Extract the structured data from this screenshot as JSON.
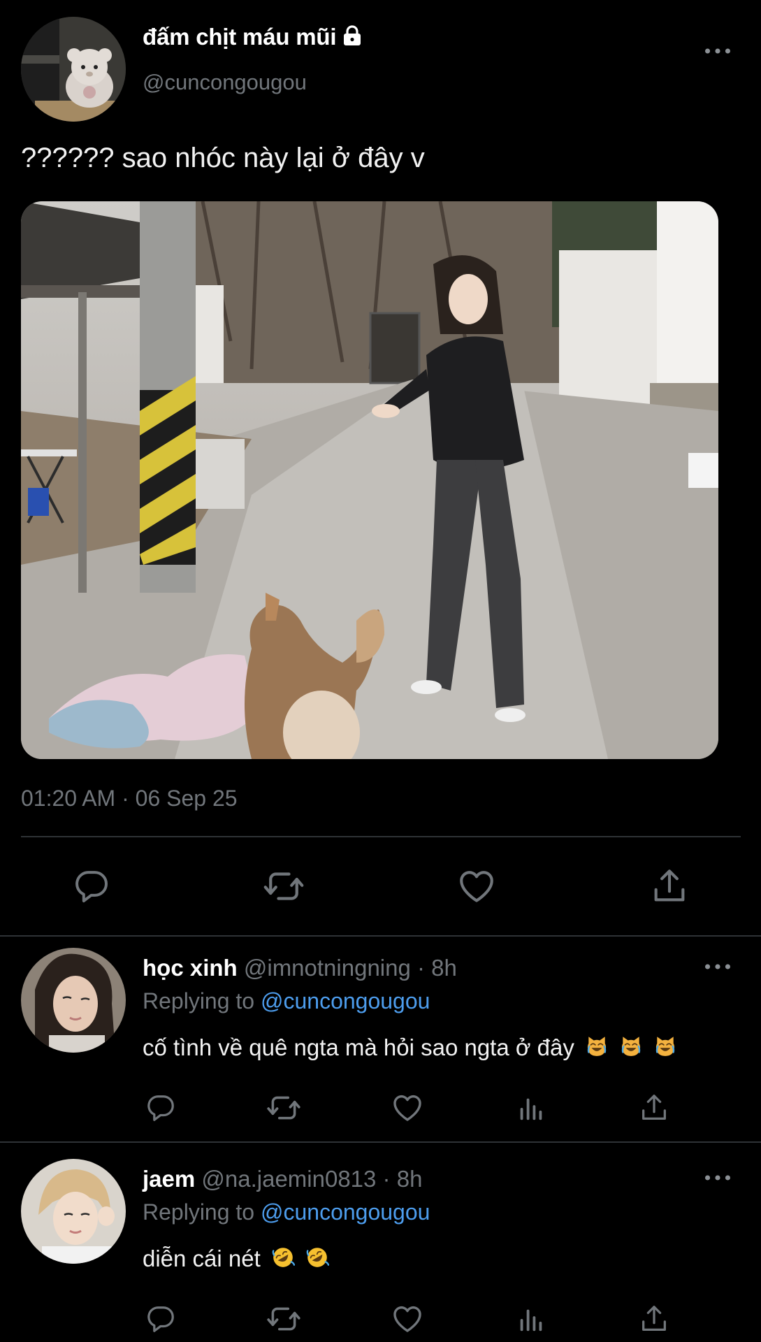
{
  "tweet": {
    "author_name": "đấm chịt máu mũi",
    "author_handle": "@cuncongougou",
    "text": "?????? sao nhóc này lại ở đây v",
    "timestamp": "01:20 AM · 06 Sep 25"
  },
  "replies": [
    {
      "name": "học xinh",
      "meta": "@imnotningning · 8h",
      "replying_prefix": "Replying to",
      "replying_handle": "@cuncongougou",
      "text": "cố tình về quê ngta mà hỏi sao ngta ở đây",
      "emoji": [
        "laughing-cat",
        "laughing-cat",
        "laughing-cat"
      ]
    },
    {
      "name": "jaem",
      "meta": "@na.jaemin0813 · 8h",
      "replying_prefix": "Replying to",
      "replying_handle": "@cuncongougou",
      "text": "diễn cái nét",
      "emoji": [
        "rofl",
        "rofl"
      ]
    }
  ],
  "icons": {
    "lock": "lock-icon",
    "more": "more-icon",
    "reply": "reply-icon",
    "retweet": "retweet-icon",
    "like": "heart-icon",
    "views": "views-icon",
    "share": "share-icon"
  },
  "colors": {
    "background": "#000000",
    "text_primary": "#ffffff",
    "text_secondary": "#71767b",
    "accent": "#4d9ded",
    "divider": "#2f3336"
  }
}
